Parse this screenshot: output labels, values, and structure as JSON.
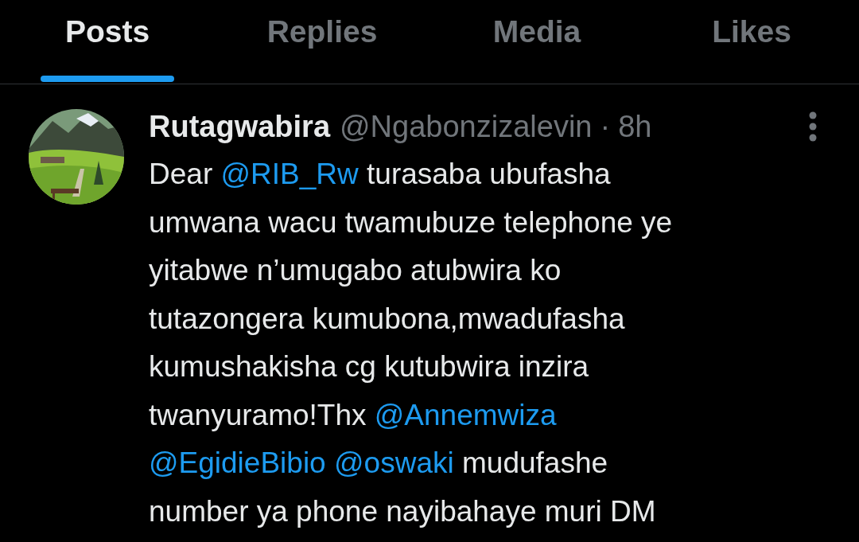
{
  "tabs": [
    {
      "label": "Posts",
      "selected": true
    },
    {
      "label": "Replies",
      "selected": false
    },
    {
      "label": "Media",
      "selected": false
    },
    {
      "label": "Likes",
      "selected": false
    }
  ],
  "post": {
    "name": "Rutagwabira",
    "handle": "@Ngabonzizalevin",
    "separator": "·",
    "time": "8h",
    "body": [
      {
        "kind": "text",
        "text": "Dear "
      },
      {
        "kind": "mention",
        "text": "@RIB_Rw"
      },
      {
        "kind": "text",
        "text": " turasaba ubufasha\numwana wacu twamubuze telephone ye\nyitabwe n’umugabo atubwira ko\ntutazongera kumubona,mwadufasha\nkumushakisha cg kutubwira inzira\ntwanyuramo!Thx "
      },
      {
        "kind": "mention",
        "text": "@Annemwiza"
      },
      {
        "kind": "break"
      },
      {
        "kind": "mention",
        "text": "@EgidieBibio"
      },
      {
        "kind": "space"
      },
      {
        "kind": "mention",
        "text": "@oswaki"
      },
      {
        "kind": "text",
        "text": " mudufashe\nnumber ya phone nayibahaye muri DM"
      }
    ]
  }
}
